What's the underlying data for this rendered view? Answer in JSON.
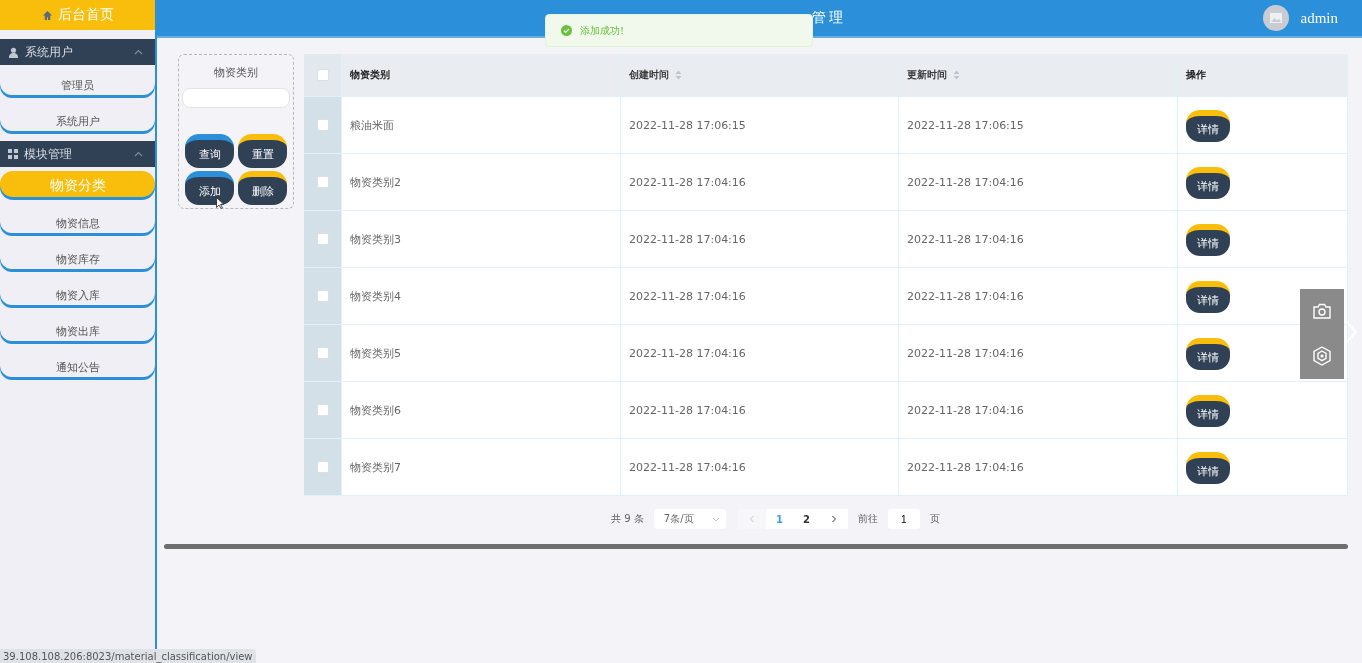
{
  "sidebar": {
    "home": "后台首页",
    "groups": [
      {
        "title": "系统用户",
        "expanded": true,
        "items": [
          {
            "label": "管理员",
            "selected": false
          },
          {
            "label": "系统用户",
            "selected": false
          }
        ]
      },
      {
        "title": "模块管理",
        "expanded": true,
        "items": [
          {
            "label": "物资分类",
            "selected": true
          },
          {
            "label": "物资信息",
            "selected": false
          },
          {
            "label": "物资库存",
            "selected": false
          },
          {
            "label": "物资入库",
            "selected": false
          },
          {
            "label": "物资出库",
            "selected": false
          },
          {
            "label": "通知公告",
            "selected": false
          }
        ]
      }
    ]
  },
  "header": {
    "title": "管理",
    "user": "admin"
  },
  "toast": {
    "message": "添加成功!"
  },
  "search": {
    "label": "物资类别",
    "buttons": [
      {
        "label": "查询",
        "color": "#2b90d9"
      },
      {
        "label": "重置",
        "color": "#f9be0b"
      },
      {
        "label": "添加",
        "color": "#2b90d9"
      },
      {
        "label": "删除",
        "color": "#f9be0b"
      }
    ]
  },
  "table": {
    "all_checked": false,
    "columns": [
      {
        "label": "物资类别",
        "sortable": false
      },
      {
        "label": "创建时间",
        "sortable": true
      },
      {
        "label": "更新时间",
        "sortable": true
      },
      {
        "label": "操作",
        "sortable": false
      }
    ],
    "rows": [
      {
        "checked": false,
        "category": "粮油米面",
        "created": "2022-11-28 17:06:15",
        "updated": "2022-11-28 17:06:15",
        "action": "详情"
      },
      {
        "checked": false,
        "category": "物资类别2",
        "created": "2022-11-28 17:04:16",
        "updated": "2022-11-28 17:04:16",
        "action": "详情"
      },
      {
        "checked": false,
        "category": "物资类别3",
        "created": "2022-11-28 17:04:16",
        "updated": "2022-11-28 17:04:16",
        "action": "详情"
      },
      {
        "checked": false,
        "category": "物资类别4",
        "created": "2022-11-28 17:04:16",
        "updated": "2022-11-28 17:04:16",
        "action": "详情"
      },
      {
        "checked": false,
        "category": "物资类别5",
        "created": "2022-11-28 17:04:16",
        "updated": "2022-11-28 17:04:16",
        "action": "详情"
      },
      {
        "checked": false,
        "category": "物资类别6",
        "created": "2022-11-28 17:04:16",
        "updated": "2022-11-28 17:04:16",
        "action": "详情"
      },
      {
        "checked": false,
        "category": "物资类别7",
        "created": "2022-11-28 17:04:16",
        "updated": "2022-11-28 17:04:16",
        "action": "详情"
      }
    ]
  },
  "pagination": {
    "total": "共 9 条",
    "page_size": "7条/页",
    "pages": [
      {
        "label": "1",
        "selected": true
      },
      {
        "label": "2",
        "selected": false
      }
    ],
    "goto": "前往",
    "goto_value": "1",
    "page_unit": "页"
  },
  "status_url": "39.108.108.206:8023/material_classification/view"
}
